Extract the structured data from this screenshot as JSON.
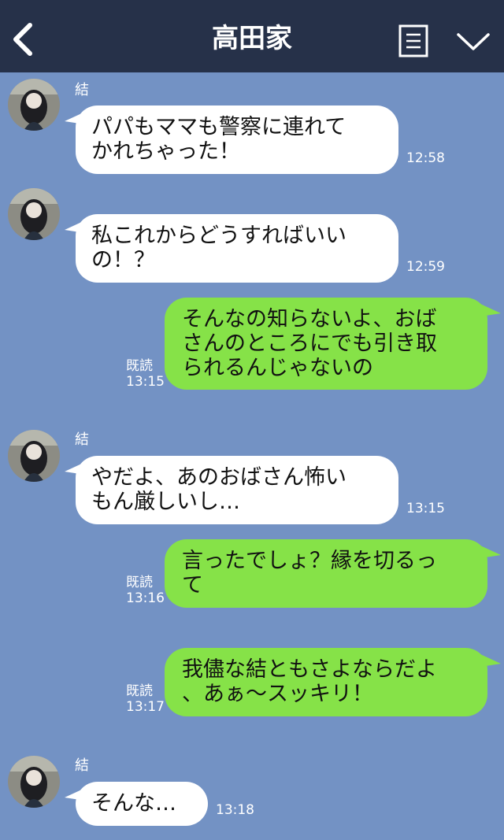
{
  "header": {
    "title": "高田家",
    "back_icon": "chevron-left-icon",
    "menu_icon": "notes-icon",
    "dropdown_icon": "chevron-down-icon"
  },
  "colors": {
    "header_bg": "#263149",
    "chat_bg": "#7392c4",
    "incoming_bubble": "#ffffff",
    "outgoing_bubble": "#86e248"
  },
  "messages": [
    {
      "direction": "incoming",
      "sender": "結",
      "lines": [
        "パパもママも警察に連れて",
        "かれちゃった！"
      ],
      "time": "12:58"
    },
    {
      "direction": "incoming",
      "sender": "",
      "lines": [
        "私これからどうすればいい",
        "の！？"
      ],
      "time": "12:59"
    },
    {
      "direction": "outgoing",
      "lines": [
        "そんなの知らないよ、おば",
        "さんのところにでも引き取",
        "られるんじゃないの"
      ],
      "read": "既読",
      "time": "13:15"
    },
    {
      "direction": "incoming",
      "sender": "結",
      "lines": [
        "やだよ、あのおばさん怖い",
        "もん厳しいし…"
      ],
      "time": "13:15"
    },
    {
      "direction": "outgoing",
      "lines": [
        "言ったでしょ？縁を切るっ",
        "て"
      ],
      "read": "既読",
      "time": "13:16"
    },
    {
      "direction": "outgoing",
      "lines": [
        "我儘な結ともさよならだよ",
        "、あぁ〜スッキリ！"
      ],
      "read": "既読",
      "time": "13:17"
    },
    {
      "direction": "incoming",
      "sender": "結",
      "lines": [
        "そんな…"
      ],
      "time": "13:18"
    }
  ]
}
